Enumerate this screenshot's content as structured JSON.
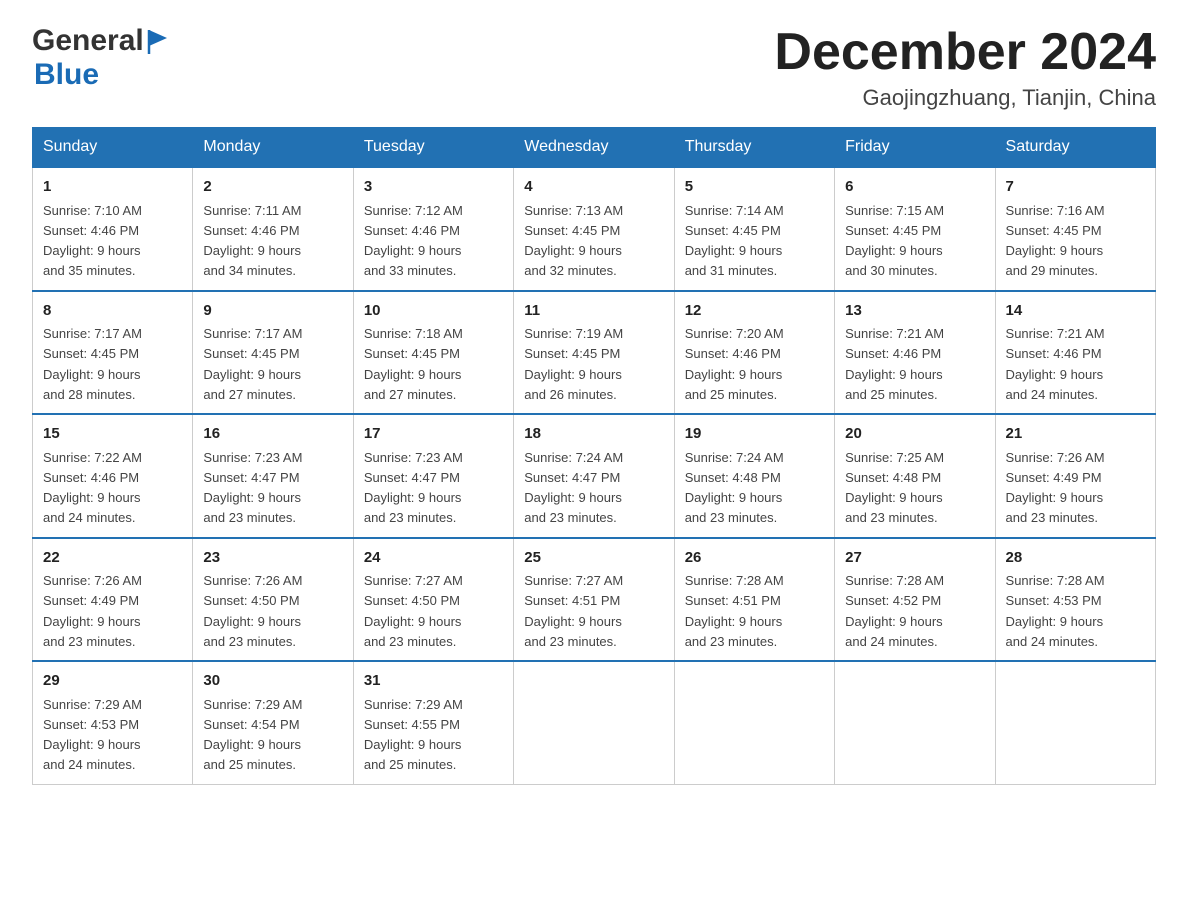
{
  "logo": {
    "line1": "General",
    "line2": "Blue"
  },
  "header": {
    "title": "December 2024",
    "subtitle": "Gaojingzhuang, Tianjin, China"
  },
  "weekdays": [
    "Sunday",
    "Monday",
    "Tuesday",
    "Wednesday",
    "Thursday",
    "Friday",
    "Saturday"
  ],
  "weeks": [
    [
      {
        "day": "1",
        "sunrise": "7:10 AM",
        "sunset": "4:46 PM",
        "daylight": "9 hours and 35 minutes."
      },
      {
        "day": "2",
        "sunrise": "7:11 AM",
        "sunset": "4:46 PM",
        "daylight": "9 hours and 34 minutes."
      },
      {
        "day": "3",
        "sunrise": "7:12 AM",
        "sunset": "4:46 PM",
        "daylight": "9 hours and 33 minutes."
      },
      {
        "day": "4",
        "sunrise": "7:13 AM",
        "sunset": "4:45 PM",
        "daylight": "9 hours and 32 minutes."
      },
      {
        "day": "5",
        "sunrise": "7:14 AM",
        "sunset": "4:45 PM",
        "daylight": "9 hours and 31 minutes."
      },
      {
        "day": "6",
        "sunrise": "7:15 AM",
        "sunset": "4:45 PM",
        "daylight": "9 hours and 30 minutes."
      },
      {
        "day": "7",
        "sunrise": "7:16 AM",
        "sunset": "4:45 PM",
        "daylight": "9 hours and 29 minutes."
      }
    ],
    [
      {
        "day": "8",
        "sunrise": "7:17 AM",
        "sunset": "4:45 PM",
        "daylight": "9 hours and 28 minutes."
      },
      {
        "day": "9",
        "sunrise": "7:17 AM",
        "sunset": "4:45 PM",
        "daylight": "9 hours and 27 minutes."
      },
      {
        "day": "10",
        "sunrise": "7:18 AM",
        "sunset": "4:45 PM",
        "daylight": "9 hours and 27 minutes."
      },
      {
        "day": "11",
        "sunrise": "7:19 AM",
        "sunset": "4:45 PM",
        "daylight": "9 hours and 26 minutes."
      },
      {
        "day": "12",
        "sunrise": "7:20 AM",
        "sunset": "4:46 PM",
        "daylight": "9 hours and 25 minutes."
      },
      {
        "day": "13",
        "sunrise": "7:21 AM",
        "sunset": "4:46 PM",
        "daylight": "9 hours and 25 minutes."
      },
      {
        "day": "14",
        "sunrise": "7:21 AM",
        "sunset": "4:46 PM",
        "daylight": "9 hours and 24 minutes."
      }
    ],
    [
      {
        "day": "15",
        "sunrise": "7:22 AM",
        "sunset": "4:46 PM",
        "daylight": "9 hours and 24 minutes."
      },
      {
        "day": "16",
        "sunrise": "7:23 AM",
        "sunset": "4:47 PM",
        "daylight": "9 hours and 23 minutes."
      },
      {
        "day": "17",
        "sunrise": "7:23 AM",
        "sunset": "4:47 PM",
        "daylight": "9 hours and 23 minutes."
      },
      {
        "day": "18",
        "sunrise": "7:24 AM",
        "sunset": "4:47 PM",
        "daylight": "9 hours and 23 minutes."
      },
      {
        "day": "19",
        "sunrise": "7:24 AM",
        "sunset": "4:48 PM",
        "daylight": "9 hours and 23 minutes."
      },
      {
        "day": "20",
        "sunrise": "7:25 AM",
        "sunset": "4:48 PM",
        "daylight": "9 hours and 23 minutes."
      },
      {
        "day": "21",
        "sunrise": "7:26 AM",
        "sunset": "4:49 PM",
        "daylight": "9 hours and 23 minutes."
      }
    ],
    [
      {
        "day": "22",
        "sunrise": "7:26 AM",
        "sunset": "4:49 PM",
        "daylight": "9 hours and 23 minutes."
      },
      {
        "day": "23",
        "sunrise": "7:26 AM",
        "sunset": "4:50 PM",
        "daylight": "9 hours and 23 minutes."
      },
      {
        "day": "24",
        "sunrise": "7:27 AM",
        "sunset": "4:50 PM",
        "daylight": "9 hours and 23 minutes."
      },
      {
        "day": "25",
        "sunrise": "7:27 AM",
        "sunset": "4:51 PM",
        "daylight": "9 hours and 23 minutes."
      },
      {
        "day": "26",
        "sunrise": "7:28 AM",
        "sunset": "4:51 PM",
        "daylight": "9 hours and 23 minutes."
      },
      {
        "day": "27",
        "sunrise": "7:28 AM",
        "sunset": "4:52 PM",
        "daylight": "9 hours and 24 minutes."
      },
      {
        "day": "28",
        "sunrise": "7:28 AM",
        "sunset": "4:53 PM",
        "daylight": "9 hours and 24 minutes."
      }
    ],
    [
      {
        "day": "29",
        "sunrise": "7:29 AM",
        "sunset": "4:53 PM",
        "daylight": "9 hours and 24 minutes."
      },
      {
        "day": "30",
        "sunrise": "7:29 AM",
        "sunset": "4:54 PM",
        "daylight": "9 hours and 25 minutes."
      },
      {
        "day": "31",
        "sunrise": "7:29 AM",
        "sunset": "4:55 PM",
        "daylight": "9 hours and 25 minutes."
      },
      null,
      null,
      null,
      null
    ]
  ],
  "labels": {
    "sunrise": "Sunrise:",
    "sunset": "Sunset:",
    "daylight": "Daylight:"
  }
}
